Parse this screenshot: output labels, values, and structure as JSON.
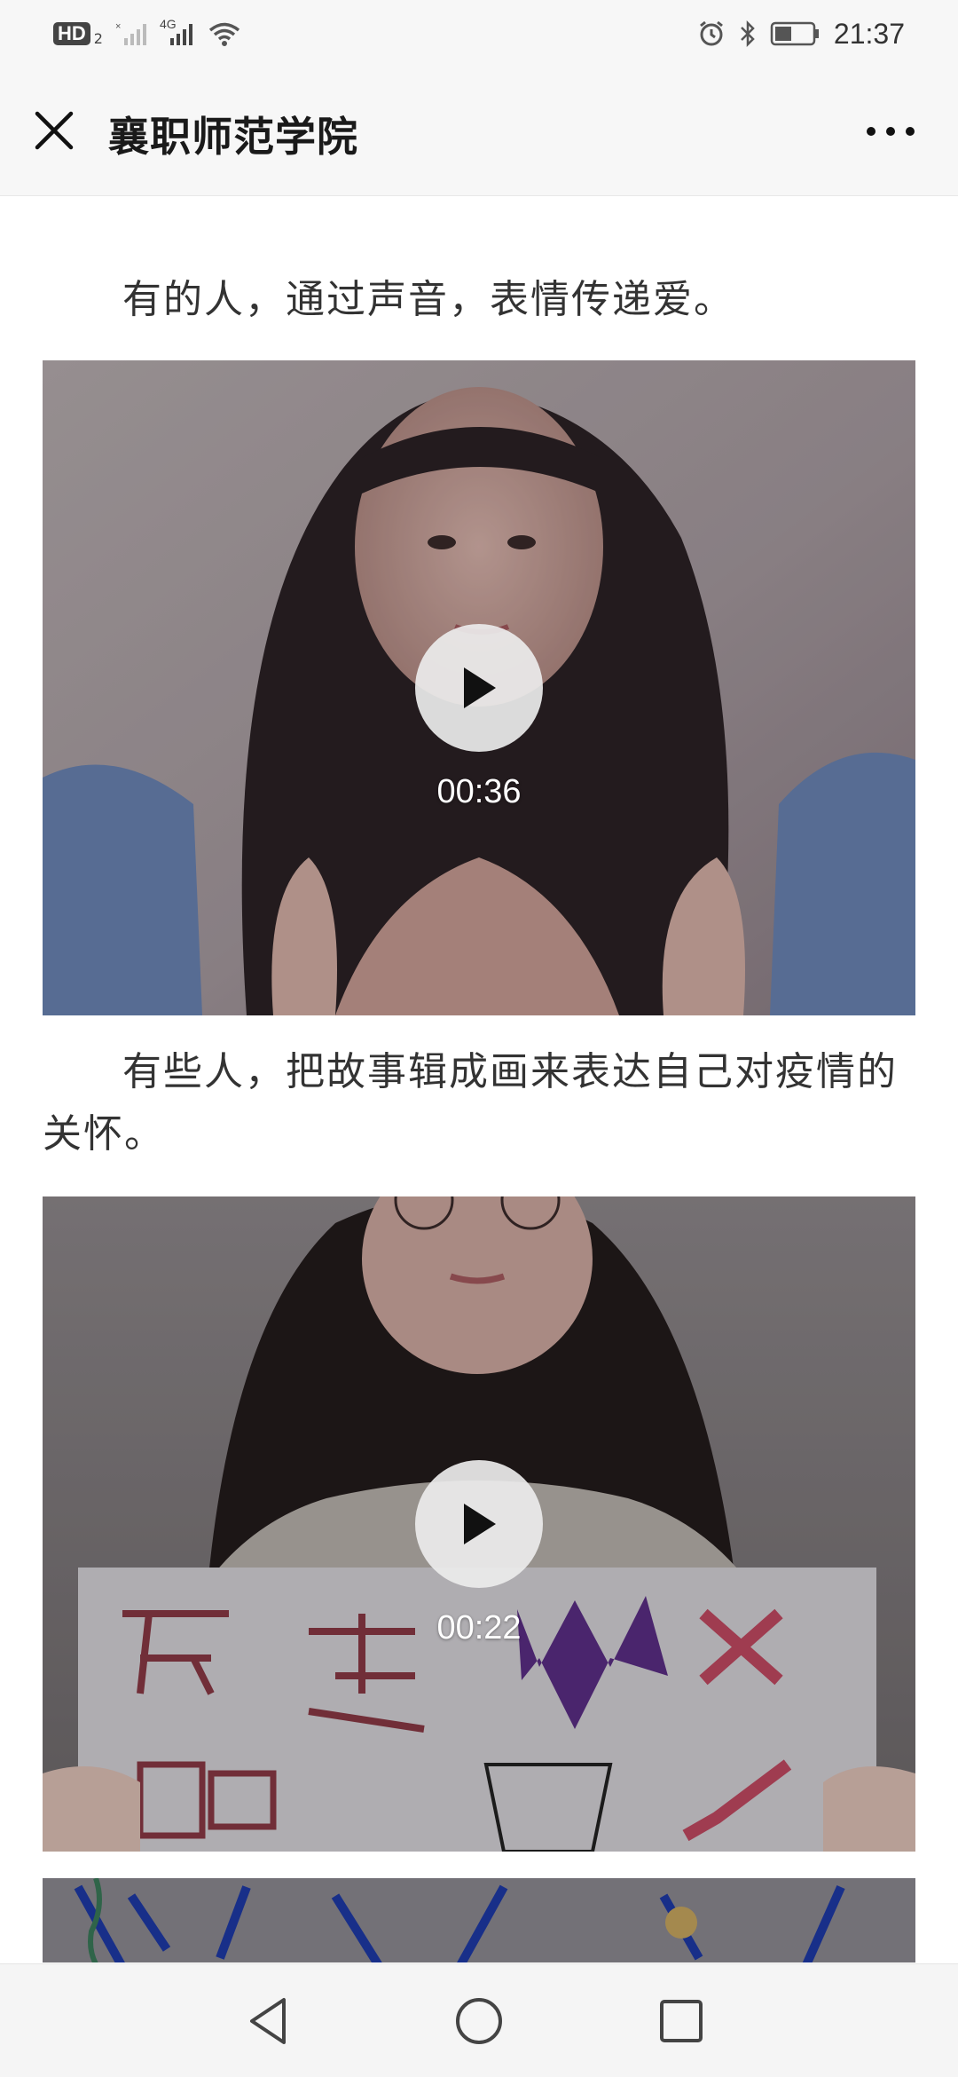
{
  "status_bar": {
    "hd_label": "HD",
    "hd_sub": "2",
    "network_label": "4G",
    "time": "21:37",
    "icons": [
      "signal-x-icon",
      "signal-4g-icon",
      "wifi-icon",
      "alarm-icon",
      "bluetooth-icon",
      "battery-icon"
    ]
  },
  "header": {
    "title": "襄职师范学院",
    "close_icon": "close-icon",
    "more_icon": "more-icon"
  },
  "article": {
    "paragraph_1": "有的人，通过声音，表情传递爱。",
    "video_1": {
      "duration": "00:36"
    },
    "paragraph_2": "有些人，把故事辑成画来表达自己对疫情的关怀。",
    "video_2": {
      "duration": "00:22"
    }
  },
  "nav_bar": {
    "icons": [
      "back-triangle-icon",
      "home-circle-icon",
      "recents-square-icon"
    ]
  },
  "colors": {
    "status_bg": "#f7f7f7",
    "title_text": "#1a1a1a",
    "body_text": "#333333",
    "nav_bg": "#f5f5f5"
  }
}
